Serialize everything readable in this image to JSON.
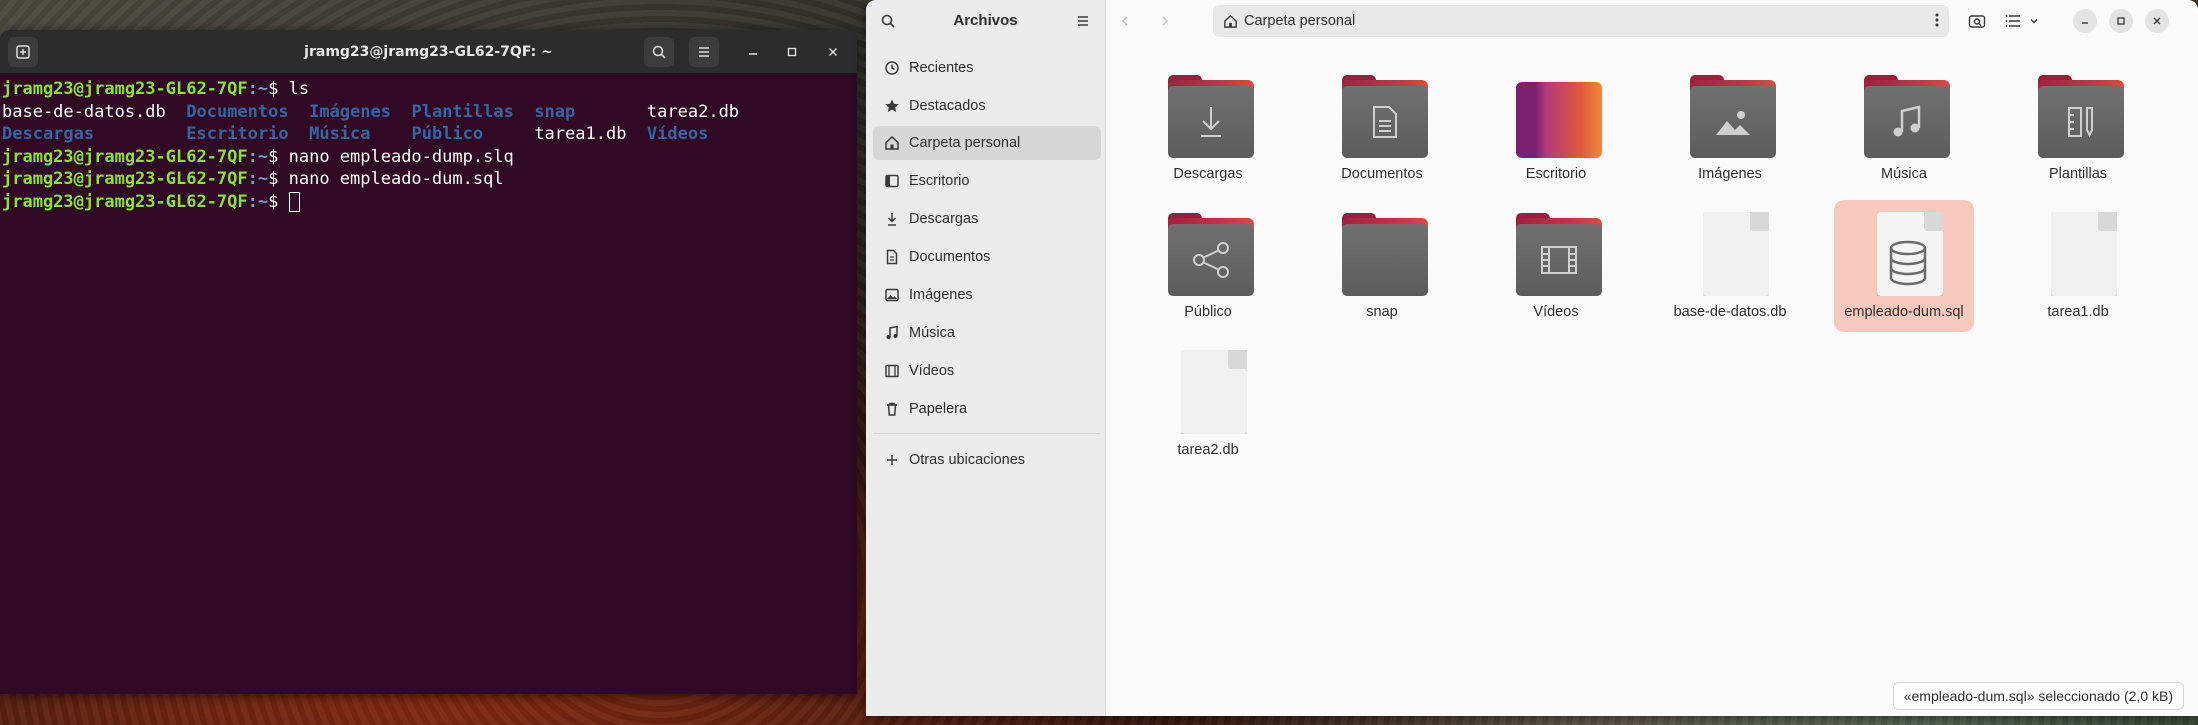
{
  "terminal": {
    "title": "jramg23@jramg23-GL62-7QF: ~",
    "prompt_user": "jramg23@jramg23-GL62-7QF",
    "prompt_path": ":~",
    "prompt_sign": "$ ",
    "cmd1": "ls",
    "ls_row1": {
      "f1": "base-de-datos.db",
      "d1": "Documentos",
      "d2": "Imágenes",
      "d3": "Plantillas",
      "d4": "snap",
      "f2": "tarea2.db"
    },
    "ls_row2": {
      "d1": "Descargas",
      "d2": "Escritorio",
      "d3": "Música",
      "d4": "Público",
      "f1": "tarea1.db",
      "d5": "Vídeos"
    },
    "cmd2": "nano empleado-dump.slq",
    "cmd3": "nano empleado-dum.sql"
  },
  "files": {
    "title": "Archivos",
    "path": "Carpeta personal",
    "sidebar": [
      {
        "label": "Recientes",
        "icon": "clock-icon"
      },
      {
        "label": "Destacados",
        "icon": "star-icon"
      },
      {
        "label": "Carpeta personal",
        "icon": "home-icon"
      },
      {
        "label": "Escritorio",
        "icon": "desktop-icon"
      },
      {
        "label": "Descargas",
        "icon": "download-icon"
      },
      {
        "label": "Documentos",
        "icon": "document-icon"
      },
      {
        "label": "Imágenes",
        "icon": "image-icon"
      },
      {
        "label": "Música",
        "icon": "music-icon"
      },
      {
        "label": "Vídeos",
        "icon": "video-icon"
      },
      {
        "label": "Papelera",
        "icon": "trash-icon"
      },
      {
        "label": "Otras ubicaciones",
        "icon": "plus-icon"
      }
    ],
    "items": [
      {
        "label": "Descargas"
      },
      {
        "label": "Documentos"
      },
      {
        "label": "Escritorio"
      },
      {
        "label": "Imágenes"
      },
      {
        "label": "Música"
      },
      {
        "label": "Plantillas"
      },
      {
        "label": "Público"
      },
      {
        "label": "snap"
      },
      {
        "label": "Vídeos"
      },
      {
        "label": "base-de-datos.db"
      },
      {
        "label": "empleado-dum.sql"
      },
      {
        "label": "tarea1.db"
      },
      {
        "label": "tarea2.db"
      }
    ],
    "status": "«empleado-dum.sql» seleccionado  (2,0 kB)"
  }
}
